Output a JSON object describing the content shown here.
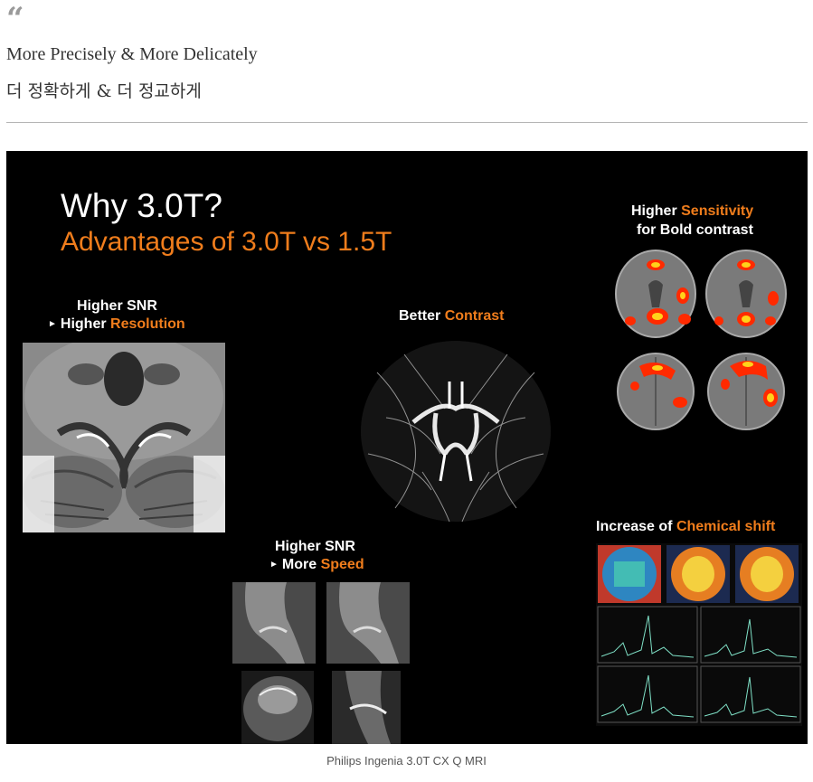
{
  "article": {
    "quote_mark": "“",
    "headline_en": "More Precisely & More Delicately",
    "headline_ko": "더 정확하게 & 더 정교하게",
    "caption": "Philips Ingenia 3.0T CX Q MRI"
  },
  "slide": {
    "title": "Why 3.0T?",
    "subtitle": "Advantages of 3.0T vs 1.5T",
    "accent_color": "#f07d1c",
    "panels": {
      "snr_resolution": {
        "line1": "Higher SNR",
        "arrow": "►",
        "line2_pre": "Higher ",
        "line2_accent": "Resolution"
      },
      "contrast": {
        "pre": "Better ",
        "accent": "Contrast"
      },
      "sensitivity": {
        "line1_pre": "Higher ",
        "line1_accent": "Sensitivity",
        "line2": "for Bold contrast"
      },
      "snr_speed": {
        "line1": "Higher SNR",
        "arrow": "►",
        "line2_pre": "More ",
        "line2_accent": "Speed"
      },
      "chemical_shift": {
        "pre": "Increase of ",
        "accent": "Chemical shift"
      }
    }
  }
}
